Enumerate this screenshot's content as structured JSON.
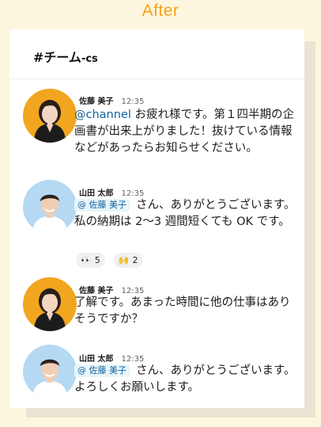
{
  "heading": "After",
  "channel": {
    "name": "#チーム",
    "suffix": "-cs"
  },
  "messages": [
    {
      "author": "佐藤 美子",
      "time": "12:35",
      "mention": "@channel",
      "text": " お疲れ様です。第１四半期の企画書が出来上がりました！抜けている情報などがあったらお知らせください。",
      "avatar": "female-avatar"
    },
    {
      "author": "山田 太郎",
      "time": "12:35",
      "mention": "@ 佐藤 美子",
      "text": "さん、ありがとうございます。私の納期は 2〜3 週間短くても OK です。",
      "avatar": "male-avatar",
      "reactions": [
        {
          "icon": "eyes-emoji",
          "glyph": "👀",
          "count": "5"
        },
        {
          "icon": "raised-hands-emoji",
          "glyph": "🙌",
          "count": "2"
        }
      ]
    },
    {
      "author": "佐藤 美子",
      "time": "12:35",
      "text": "了解です。あまった時間に他の仕事はありそうですか？",
      "avatar": "female-avatar"
    },
    {
      "author": "山田 太郎",
      "time": "12:35",
      "mention": "@ 佐藤 美子",
      "text": "さん、ありがとうございます。よろしくお願いします。",
      "avatar": "male-avatar"
    }
  ],
  "colors": {
    "page_bg": "#fdf6de",
    "heading": "#f3a41c",
    "female_avatar_bg": "#f2a51e",
    "male_avatar_bg": "#b5d9f2",
    "link": "#1264a3"
  }
}
